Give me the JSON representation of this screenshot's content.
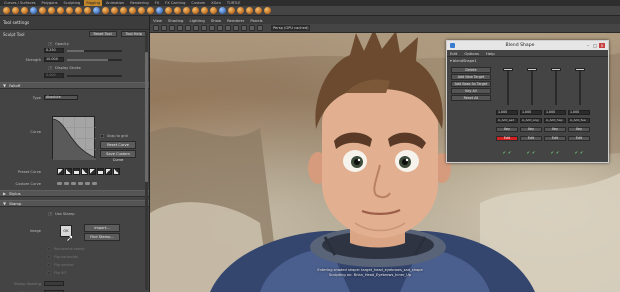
{
  "shelf": {
    "tabs": [
      "Curves / Surfaces",
      "Polygons",
      "Sculpting",
      "Rigging",
      "Animation",
      "Rendering",
      "FX",
      "FX Caching",
      "Custom",
      "XGen",
      "TURTLE"
    ],
    "active_tab_index": 3
  },
  "tool_settings": {
    "title": "Tool settings",
    "tool_name": "Sculpt Tool",
    "reset_label": "Reset Tool",
    "help_label": "Tool Help",
    "rows": {
      "opacity_label": "Opacity",
      "size_value": "0.250",
      "strength_label": "Strength",
      "strength_value": "10.000",
      "stamp_label": "Display Stroke",
      "unused_value": "0.000"
    },
    "sections": {
      "falloff": "Falloff",
      "stylus": "Stylus",
      "stamp": "Stamp"
    },
    "falloff": {
      "type_label": "Type",
      "type_value": "Absolute",
      "curve_label": "Curve",
      "snap_label": "Snap to grid",
      "reset_curve": "Reset Curve",
      "save_curve": "Save Custom Curve",
      "preset_label": "Preset Curve",
      "custom_label": "Custom Curve"
    },
    "stamp": {
      "use_stamp_label": "Use Stamp",
      "image_label": "Image",
      "thumb_text": "OK",
      "import_btn": "Import...",
      "find_btn": "Find Stamp...",
      "dim_rows": [
        "Randomize stamp",
        "Flip horizontal",
        "Flip vertical",
        "Flip 90°"
      ],
      "spacing_label": "Stamp Spacing",
      "orient_label": "Orientation"
    }
  },
  "viewport": {
    "menu": [
      "View",
      "Shading",
      "Lighting",
      "Show",
      "Renderer",
      "Panels"
    ],
    "camera": "Persp (GPU cached)",
    "subtitle_line1": "Entering shaded shape: target_head_eyebrows_sad_shape",
    "subtitle_line2": "Sculpting on: Brian_Head_Eyebrows_Inner_Up"
  },
  "blend_shape": {
    "title": "Blend Shape",
    "menu": [
      "Edit",
      "Options",
      "Help"
    ],
    "node": "blendShape1",
    "left_buttons": [
      "Delete",
      "Add New Target",
      "Add Base As Target",
      "Key All",
      "Reset All"
    ],
    "values": [
      "1.000",
      "1.000",
      "1.000",
      "1.000"
    ],
    "target_names": [
      "A_Add_sad",
      "A_Add_ang",
      "A_Add_hap",
      "A_Add_fea"
    ],
    "slider_levels": [
      1.0,
      1.0,
      1.0,
      1.0
    ],
    "key_label": "Key",
    "edit_label": "Edit",
    "colors": {
      "edit_active": "#d42020",
      "window_border": "#cfcfcf"
    }
  }
}
